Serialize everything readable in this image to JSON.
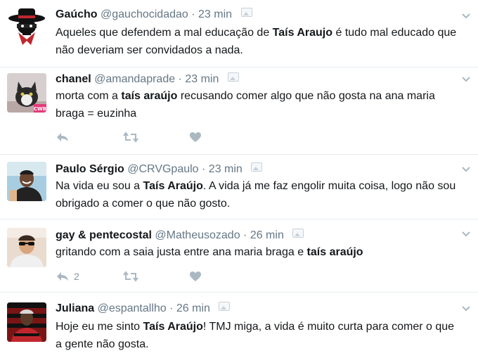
{
  "tweets": [
    {
      "name": "Gaúcho",
      "handle": "@gauchocidadao",
      "time": "23 min",
      "text_before": "Aqueles que defendem a mal educação de ",
      "text_bold": "Taís Araujo",
      "text_after": " é tudo mal educado que não deveriam ser convidados a nada.",
      "avatar": "gaucho-hat-mask-avatar"
    },
    {
      "name": "chanel",
      "handle": "@amandaprade",
      "time": "23 min",
      "text_before": "morta com a ",
      "text_bold": "taís araújo",
      "text_after": " recusando comer algo que não gosta na ana maria braga = euzinha",
      "avatar": "cat-avatar",
      "avatar_caption": "CWB",
      "reply_count": "",
      "retweet_count": "",
      "like_count": ""
    },
    {
      "name": "Paulo Sérgio",
      "handle": "@CRVGpaulo",
      "time": "23 min",
      "text_before": "Na vida eu sou a ",
      "text_bold": "Taís Araújo",
      "text_after": ". A vida já me faz engolir muita coisa, logo não sou obrigado a comer o que não gosto.",
      "avatar": "man-smiling-avatar"
    },
    {
      "name": "gay & pentecostal",
      "handle": "@Matheusozado",
      "time": "26 min",
      "text_before": "gritando com a saia justa entre ana maria braga e ",
      "text_bold": "taís araújo",
      "text_after": "",
      "avatar": "man-sunglasses-avatar",
      "reply_count": "2",
      "retweet_count": "",
      "like_count": ""
    },
    {
      "name": "Juliana",
      "handle": "@espantallho",
      "time": "26 min",
      "text_before": "Hoje eu me sinto ",
      "text_bold": "Taís Araújo",
      "text_after": "! TMJ miga, a vida é muito curta para comer o que a gente não gosta.",
      "avatar": "flamengo-fan-avatar"
    }
  ],
  "separator": " · ",
  "colors": {
    "text": "#14171a",
    "secondary": "#657786",
    "action_icon": "#aab8c2",
    "divider": "#e6ecf0"
  }
}
